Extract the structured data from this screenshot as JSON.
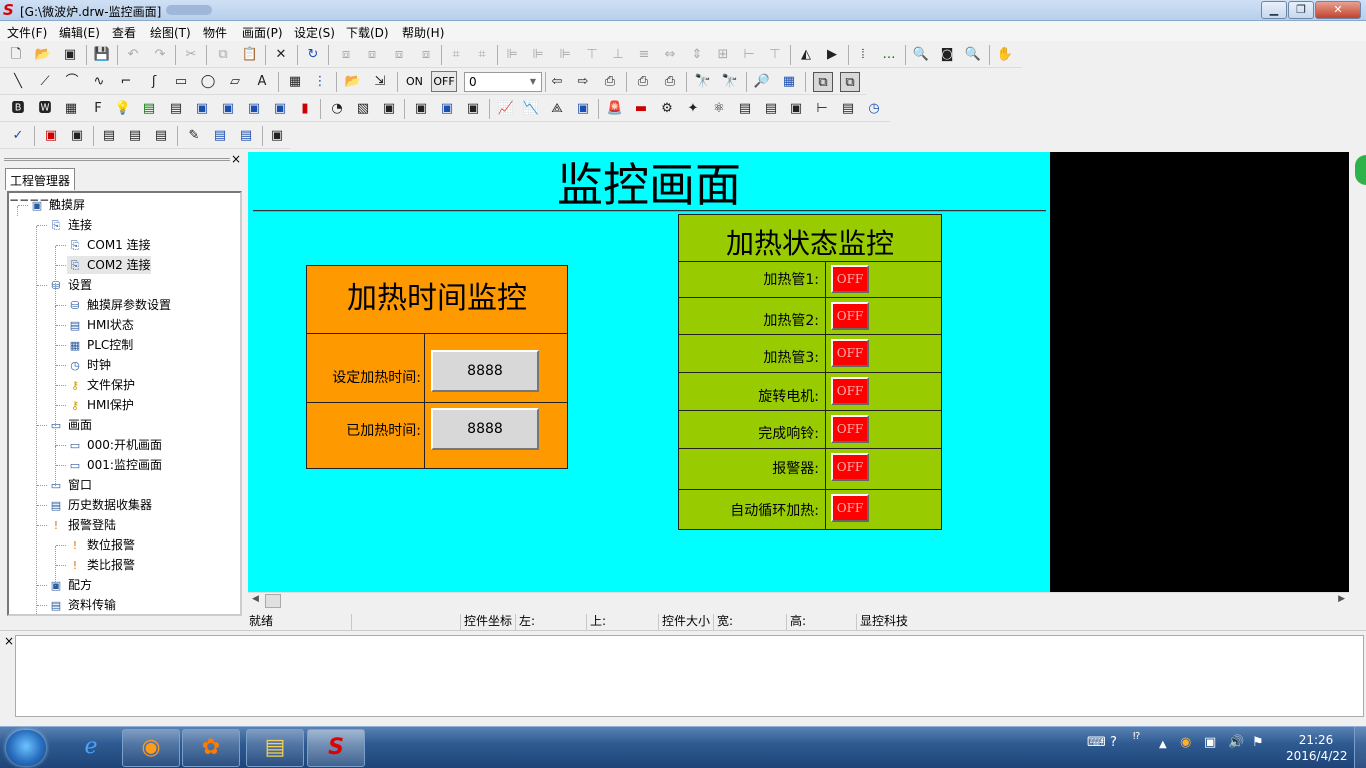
{
  "window": {
    "title": "[G:\\微波炉.drw-监控画面]",
    "logo": "S",
    "minimize": "▁",
    "restore": "❐",
    "close": "✕"
  },
  "menu": [
    "文件(F)",
    "编辑(E)",
    "查看",
    "绘图(T)",
    "物件",
    "画面(P)",
    "设定(S)",
    "下载(D)",
    "帮助(H)"
  ],
  "toolbar": {
    "on_label": "ON",
    "off_label": "OFF",
    "combo_value": "0"
  },
  "panel": {
    "tab": "工程管理器",
    "close": "×",
    "tree": [
      {
        "label": "触摸屏",
        "icon": "touchscreen-icon",
        "glyph": "▣",
        "level": 0,
        "pm": "−"
      },
      {
        "label": "连接",
        "icon": "connection-icon",
        "glyph": "⎘",
        "level": 1,
        "pm": "−"
      },
      {
        "label": "COM1 连接",
        "icon": "com-port-icon",
        "glyph": "⎘",
        "level": 2
      },
      {
        "label": "COM2 连接",
        "icon": "com-port-icon",
        "glyph": "⎘",
        "level": 2,
        "selected": true
      },
      {
        "label": "设置",
        "icon": "database-icon",
        "glyph": "⛁",
        "level": 1,
        "pm": "−"
      },
      {
        "label": "触摸屏参数设置",
        "icon": "database-icon",
        "glyph": "⛁",
        "level": 2
      },
      {
        "label": "HMI状态",
        "icon": "hmi-status-icon",
        "glyph": "▤",
        "level": 2
      },
      {
        "label": "PLC控制",
        "icon": "plc-icon",
        "glyph": "▦",
        "level": 2
      },
      {
        "label": "时钟",
        "icon": "clock-icon",
        "glyph": "◷",
        "level": 2
      },
      {
        "label": "文件保护",
        "icon": "key-icon",
        "glyph": "⚷",
        "level": 2
      },
      {
        "label": "HMI保护",
        "icon": "key-icon",
        "glyph": "⚷",
        "level": 2
      },
      {
        "label": "画面",
        "icon": "screen-icon",
        "glyph": "▭",
        "level": 1,
        "pm": "−"
      },
      {
        "label": "000:开机画面",
        "icon": "screen-icon",
        "glyph": "▭",
        "level": 2
      },
      {
        "label": "001:监控画面",
        "icon": "screen-icon",
        "glyph": "▭",
        "level": 2
      },
      {
        "label": "窗口",
        "icon": "window-icon",
        "glyph": "▭",
        "level": 1
      },
      {
        "label": "历史数据收集器",
        "icon": "data-collector-icon",
        "glyph": "▤",
        "level": 1
      },
      {
        "label": "报警登陆",
        "icon": "alarm-icon",
        "glyph": "!",
        "level": 1,
        "pm": "−"
      },
      {
        "label": "数位报警",
        "icon": "alarm-icon",
        "glyph": "!",
        "level": 2
      },
      {
        "label": "类比报警",
        "icon": "alarm-icon",
        "glyph": "!",
        "level": 2
      },
      {
        "label": "配方",
        "icon": "recipe-icon",
        "glyph": "▣",
        "level": 1
      },
      {
        "label": "资料传输",
        "icon": "transfer-icon",
        "glyph": "▤",
        "level": 1
      }
    ]
  },
  "screen": {
    "title": "监控画面",
    "heating_time": {
      "title": "加热时间监控",
      "rows": [
        {
          "label": "设定加热时间:",
          "value": "8888"
        },
        {
          "label": "已加热时间:",
          "value": "8888"
        }
      ]
    },
    "heating_status": {
      "title": "加热状态监控",
      "rows": [
        {
          "label": "加热管1:",
          "state": "OFF"
        },
        {
          "label": "加热管2:",
          "state": "OFF"
        },
        {
          "label": "加热管3:",
          "state": "OFF"
        },
        {
          "label": "旋转电机:",
          "state": "OFF"
        },
        {
          "label": "完成响铃:",
          "state": "OFF"
        },
        {
          "label": "报警器:",
          "state": "OFF"
        },
        {
          "label": "自动循环加热:",
          "state": "OFF"
        }
      ]
    }
  },
  "statusbar": {
    "ready": "就绪",
    "coord_label": "控件坐标",
    "left": "左:",
    "top": "上:",
    "size_label": "控件大小",
    "width": "宽:",
    "height": "高:",
    "company": "显控科技"
  },
  "output": {
    "close": "×"
  },
  "taskbar": {
    "time": "21:26",
    "date": "2016/4/22"
  },
  "colors": {
    "canvas": "#00ffff",
    "time_box": "#ff9900",
    "status_box": "#99cc00",
    "led_off": "#ff0000"
  }
}
